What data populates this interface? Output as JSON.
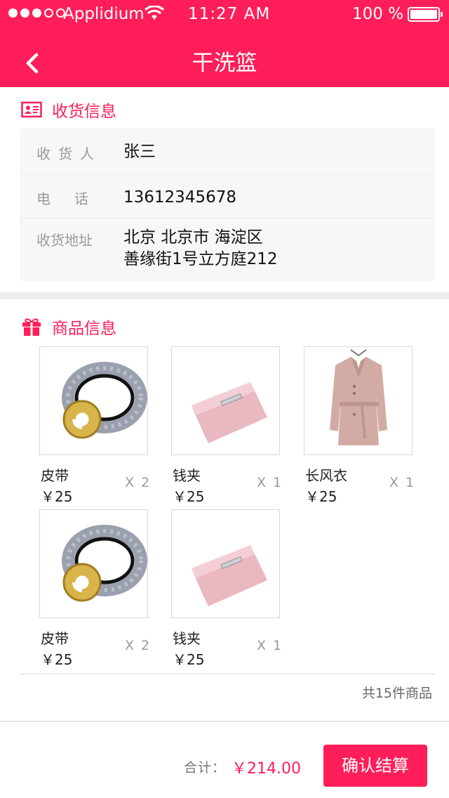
{
  "colors": {
    "accent": "#ff1e59",
    "card_bg": "#f7f7f7",
    "muted_text": "#9a9a9a"
  },
  "status_bar": {
    "signal_dots": [
      "on",
      "on",
      "on",
      "off",
      "off"
    ],
    "carrier": "Applidium",
    "wifi_icon": "wifi-icon",
    "time": "11:27  AM",
    "battery_text": "100  %",
    "battery_level": 1.0
  },
  "nav": {
    "back_icon": "chevron-left-icon",
    "title": "干洗篮"
  },
  "receiver_section": {
    "title": "收货信息",
    "icon": "id-card-icon",
    "rows": [
      {
        "label": "收货人",
        "value": "张三"
      },
      {
        "label": "电话",
        "value": "13612345678"
      },
      {
        "label": "收货地址",
        "value_line1": "北京 北京市 海淀区",
        "value_line2": "善缘街1号立方庭212"
      }
    ]
  },
  "goods_section": {
    "title": "商品信息",
    "icon": "gift-icon",
    "items": [
      {
        "name": "皮带",
        "price": "￥25",
        "qty": "X 2",
        "image": "belt"
      },
      {
        "name": "钱夹",
        "price": "￥25",
        "qty": "X 1",
        "image": "wallet"
      },
      {
        "name": "长风衣",
        "price": "￥25",
        "qty": "X 1",
        "image": "trench-coat"
      },
      {
        "name": "皮带",
        "price": "￥25",
        "qty": "X 2",
        "image": "belt"
      },
      {
        "name": "钱夹",
        "price": "￥25",
        "qty": "X 1",
        "image": "wallet"
      }
    ],
    "total_count": "共15件商品"
  },
  "footer": {
    "total_label": "合计：",
    "total_amount": "￥214.00",
    "checkout_label": "确认结算"
  }
}
